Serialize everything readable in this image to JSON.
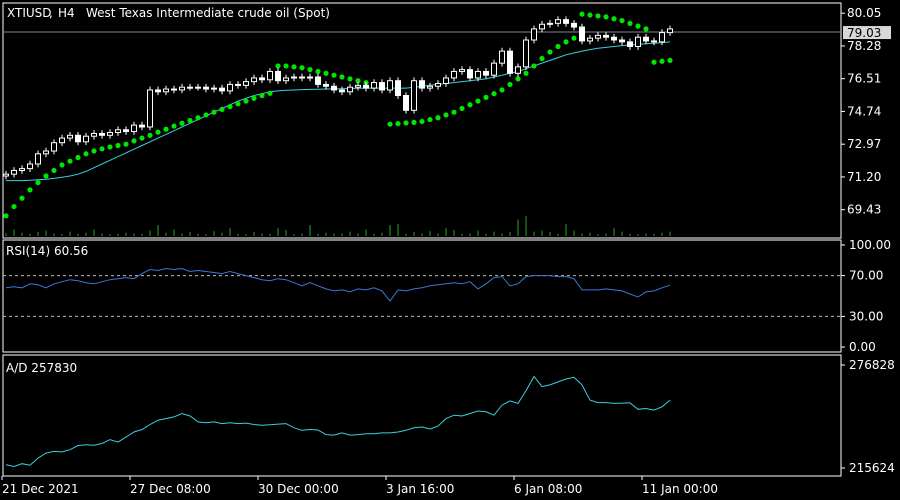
{
  "header": {
    "symbol": "XTIUSD",
    "timeframe": "H4",
    "description": "West Texas Intermediate crude oil (Spot)"
  },
  "colors": {
    "background": "#000000",
    "frame": "#ffffff",
    "bull_candle": "#ffffff",
    "bear_candle": "#ffffff",
    "sar": "#00e600",
    "ma": "#39d0e0",
    "rsi_line": "#3a78d8",
    "ad_line": "#39d0e0",
    "volume": "#22a622",
    "price_line": "#778899",
    "price_badge_bg": "#d8d8d8",
    "text": "#ffffff"
  },
  "chart_data": [
    {
      "type": "candlestick",
      "title": "XTIUSD, H4:  West Texas Intermediate crude oil (Spot)",
      "ylim": [
        67.9,
        80.6
      ],
      "y_ticks": [
        "80.05",
        "78.28",
        "76.51",
        "74.74",
        "72.97",
        "71.20",
        "69.43"
      ],
      "current_price": "79.03",
      "x_tick_labels": [
        "21 Dec 2021",
        "27 Dec 08:00",
        "30 Dec 00:00",
        "3 Jan 16:00",
        "6 Jan 08:00",
        "11 Jan 00:00"
      ],
      "close": [
        71.35,
        71.55,
        71.65,
        71.9,
        72.45,
        72.6,
        73.05,
        73.3,
        73.45,
        73.1,
        73.4,
        73.55,
        73.45,
        73.6,
        73.75,
        73.65,
        74.0,
        73.9,
        75.9,
        75.8,
        75.95,
        75.9,
        76.05,
        76.05,
        76.05,
        75.95,
        76.0,
        75.85,
        76.2,
        76.15,
        76.35,
        76.55,
        76.45,
        76.9,
        76.4,
        76.55,
        76.6,
        76.55,
        76.6,
        76.2,
        76.1,
        75.9,
        75.8,
        76.05,
        76.15,
        76.0,
        76.3,
        75.9,
        76.4,
        75.6,
        74.8,
        76.4,
        76.0,
        76.1,
        76.25,
        76.55,
        76.9,
        77.0,
        76.55,
        76.9,
        76.7,
        77.35,
        78.0,
        76.8,
        77.15,
        78.6,
        79.2,
        79.45,
        79.5,
        79.7,
        79.5,
        79.3,
        78.55,
        78.7,
        78.85,
        78.75,
        78.6,
        78.5,
        78.25,
        78.75,
        78.55,
        78.5,
        79.0,
        79.2
      ],
      "parabolic_sar": [
        69.1,
        69.6,
        70.05,
        70.5,
        70.9,
        71.25,
        71.55,
        71.85,
        72.05,
        72.25,
        72.45,
        72.6,
        72.72,
        72.82,
        72.9,
        72.97,
        73.15,
        73.3,
        73.45,
        73.62,
        73.78,
        73.95,
        74.1,
        74.25,
        74.4,
        74.55,
        74.7,
        74.85,
        75.0,
        75.15,
        75.3,
        75.45,
        75.6,
        75.72,
        77.2,
        77.2,
        77.15,
        77.1,
        77.0,
        76.9,
        76.8,
        76.7,
        76.6,
        76.5,
        76.4,
        76.3,
        76.2,
        76.1,
        74.05,
        74.08,
        74.12,
        74.15,
        74.2,
        74.3,
        74.4,
        74.55,
        74.7,
        74.9,
        75.1,
        75.3,
        75.5,
        75.7,
        75.9,
        76.2,
        76.5,
        76.8,
        77.2,
        77.6,
        77.95,
        78.25,
        78.5,
        78.7,
        80.0,
        79.95,
        79.9,
        79.85,
        79.75,
        79.65,
        79.5,
        79.35,
        79.2,
        77.4,
        77.45,
        77.5
      ],
      "moving_average": [
        71.0,
        71.0,
        71.0,
        71.02,
        71.05,
        71.08,
        71.12,
        71.18,
        71.25,
        71.35,
        71.5,
        71.7,
        71.9,
        72.1,
        72.3,
        72.5,
        72.7,
        72.9,
        73.1,
        73.3,
        73.5,
        73.7,
        73.9,
        74.1,
        74.3,
        74.5,
        74.7,
        74.9,
        75.1,
        75.3,
        75.45,
        75.6,
        75.7,
        75.8,
        75.85,
        75.88,
        75.9,
        75.92,
        75.93,
        75.94,
        75.95,
        75.96,
        75.97,
        75.98,
        75.99,
        76.0,
        76.0,
        76.0,
        76.0,
        76.0,
        76.0,
        76.05,
        76.1,
        76.15,
        76.2,
        76.25,
        76.3,
        76.35,
        76.4,
        76.45,
        76.5,
        76.6,
        76.7,
        76.8,
        76.9,
        77.05,
        77.2,
        77.35,
        77.5,
        77.65,
        77.8,
        77.9,
        78.0,
        78.08,
        78.15,
        78.2,
        78.25,
        78.3,
        78.33,
        78.36,
        78.4,
        78.43,
        78.46,
        78.5
      ],
      "volume_rel": [
        0.12,
        0.3,
        0.15,
        0.1,
        0.18,
        0.25,
        0.12,
        0.09,
        0.2,
        0.1,
        0.15,
        0.3,
        0.12,
        0.08,
        0.1,
        0.15,
        0.12,
        0.1,
        0.25,
        0.5,
        0.15,
        0.3,
        0.12,
        0.18,
        0.1,
        0.08,
        0.22,
        0.15,
        0.35,
        0.1,
        0.08,
        0.18,
        0.12,
        0.1,
        0.35,
        0.28,
        0.08,
        0.12,
        0.5,
        0.1,
        0.15,
        0.12,
        0.12,
        0.2,
        0.12,
        0.3,
        0.1,
        0.15,
        0.5,
        0.55,
        0.1,
        0.18,
        0.12,
        0.22,
        0.12,
        0.35,
        0.28,
        0.1,
        0.12,
        0.25,
        0.1,
        0.2,
        0.12,
        0.18,
        0.75,
        0.9,
        0.2,
        0.25,
        0.18,
        0.1,
        0.55,
        0.25,
        0.12,
        0.15,
        0.08,
        0.12,
        0.35,
        0.2,
        0.1,
        0.08,
        0.12,
        0.1,
        0.15,
        0.2
      ]
    },
    {
      "type": "line",
      "name": "RSI(14)",
      "label": "RSI(14) 60.56",
      "ylim": [
        0,
        100
      ],
      "y_ticks": [
        "100.00",
        "70.00",
        "30.00",
        "0.00"
      ],
      "levels": [
        70,
        30
      ],
      "values": [
        58,
        59,
        58,
        62,
        61,
        58,
        62,
        64,
        66,
        65,
        63,
        62,
        64,
        66,
        67,
        68,
        67,
        72,
        76,
        75,
        77,
        76,
        77,
        74,
        75,
        74,
        73,
        72,
        74,
        72,
        70,
        68,
        66,
        65,
        67,
        66,
        63,
        60,
        63,
        60,
        57,
        55,
        56,
        54,
        57,
        56,
        58,
        55,
        45,
        56,
        55,
        57,
        58,
        60,
        61,
        62,
        63,
        62,
        64,
        57,
        62,
        68,
        69,
        60,
        62,
        69,
        70,
        70,
        70,
        69,
        69,
        67,
        56,
        56,
        56,
        57,
        56,
        55,
        52,
        49,
        54,
        55,
        58,
        60.56
      ]
    },
    {
      "type": "line",
      "name": "A/D",
      "label": "A/D 257830",
      "ylim": [
        215624,
        276828
      ],
      "y_ticks": [
        "276828",
        "215624"
      ],
      "values": [
        217500,
        216500,
        218200,
        217300,
        221500,
        224500,
        225500,
        225200,
        226500,
        229000,
        229400,
        229100,
        230200,
        232500,
        231000,
        234000,
        237000,
        238500,
        241500,
        244000,
        245000,
        246000,
        248000,
        246500,
        243000,
        242500,
        243000,
        242000,
        242500,
        242000,
        242300,
        241500,
        241000,
        241300,
        241700,
        242000,
        239500,
        238000,
        238500,
        238200,
        235500,
        235200,
        236500,
        235200,
        235500,
        236000,
        236000,
        236500,
        236500,
        237000,
        238000,
        239500,
        240000,
        238800,
        240500,
        245000,
        247000,
        246500,
        248000,
        249500,
        249000,
        247000,
        253000,
        255500,
        254000,
        261500,
        270000,
        264000,
        265000,
        266800,
        268500,
        269500,
        265000,
        256000,
        254500,
        254500,
        254000,
        254200,
        254300,
        250500,
        251000,
        250000,
        252000,
        256000
      ]
    }
  ]
}
